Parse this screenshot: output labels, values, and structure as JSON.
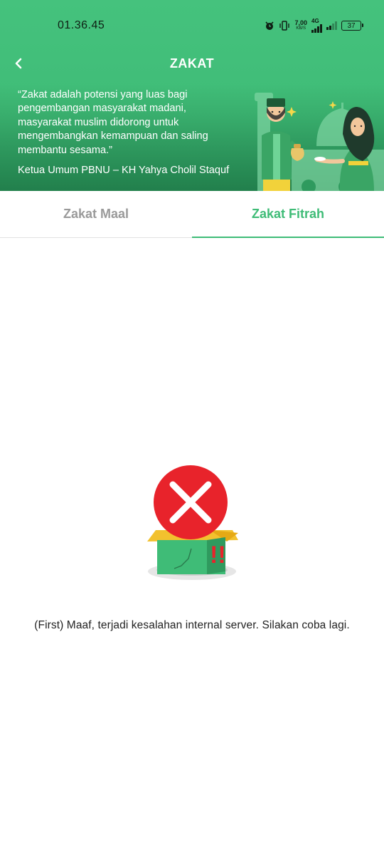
{
  "status_bar": {
    "time": "01.36.45",
    "net_speed": "7,00",
    "net_unit": "KB/S",
    "net_type": "4G",
    "battery": "37",
    "icons": [
      "alarm-icon",
      "vibrate-icon",
      "signal-icon",
      "signal-icon",
      "battery-icon"
    ]
  },
  "header": {
    "title": "ZAKAT",
    "back_icon": "chevron-left-icon",
    "quote_lines": [
      "“Zakat adalah potensi yang luas bagi",
      "pengembangan masyarakat madani,",
      "masyarakat muslim didorong untuk",
      "mengembangkan kemampuan dan saling",
      "membantu sesama.”"
    ],
    "quote_author": "Ketua Umum PBNU – KH Yahya Cholil Staquf"
  },
  "tabs": [
    {
      "label": "Zakat Maal",
      "active": false
    },
    {
      "label": "Zakat Fitrah",
      "active": true
    }
  ],
  "error": {
    "icon": "error-box-icon",
    "message": "(First) Maaf, terjadi kesalahan internal server. Silakan coba lagi."
  },
  "colors": {
    "brand_green": "#3fbc77",
    "error_red": "#e8232b",
    "inactive_tab": "#9a9a9a"
  }
}
